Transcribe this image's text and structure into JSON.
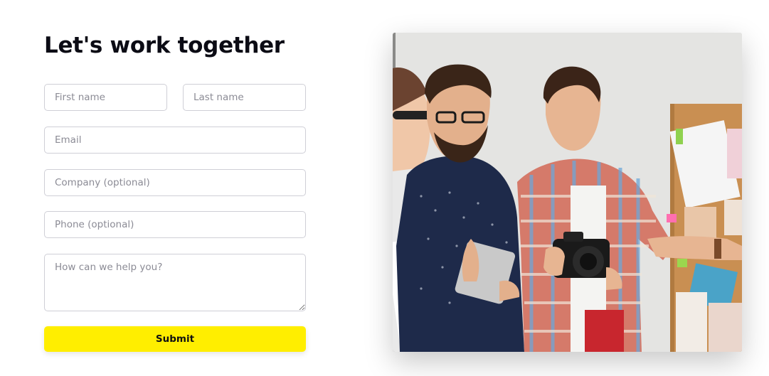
{
  "contact_form": {
    "title": "Let's work together",
    "first_name_placeholder": "First name",
    "last_name_placeholder": "Last name",
    "email_placeholder": "Email",
    "company_placeholder": "Company (optional)",
    "phone_placeholder": "Phone (optional)",
    "message_placeholder": "How can we help you?",
    "submit_label": "Submit"
  },
  "colors": {
    "submit_background": "#ffee00",
    "title_text": "#0b0b14",
    "field_border": "#cfcfd6"
  },
  "hero_image": {
    "subject": "team-photo"
  }
}
